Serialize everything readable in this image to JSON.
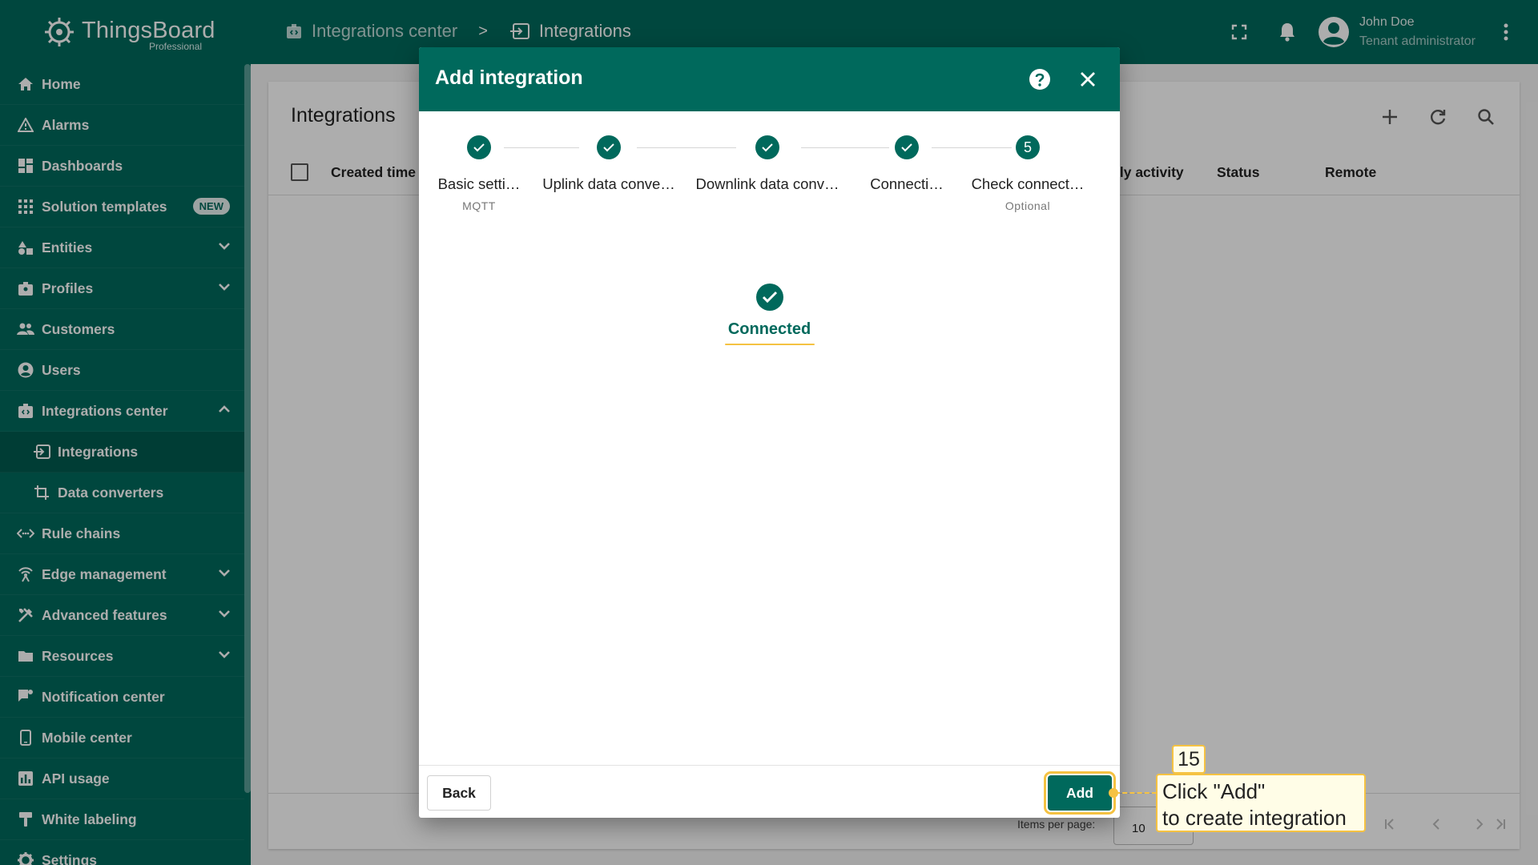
{
  "app": {
    "name": "ThingsBoard",
    "edition": "Professional"
  },
  "breadcrumb": [
    {
      "label": "Integrations center",
      "icon": "integrations-center-icon"
    },
    {
      "label": "Integrations",
      "icon": "integration-icon"
    }
  ],
  "breadcrumb_separator": ">",
  "user": {
    "name": "John Doe",
    "role": "Tenant administrator"
  },
  "sidebar": {
    "items": [
      {
        "label": "Home",
        "icon": "home-icon"
      },
      {
        "label": "Alarms",
        "icon": "alarm-icon"
      },
      {
        "label": "Dashboards",
        "icon": "dashboard-icon"
      },
      {
        "label": "Solution templates",
        "icon": "apps-icon",
        "badge": "NEW"
      },
      {
        "label": "Entities",
        "icon": "entities-icon"
      },
      {
        "label": "Profiles",
        "icon": "profiles-icon"
      },
      {
        "label": "Customers",
        "icon": "customers-icon"
      },
      {
        "label": "Users",
        "icon": "user-icon"
      },
      {
        "label": "Integrations center",
        "icon": "integrations-center-icon"
      },
      {
        "label": "Integrations",
        "icon": "integration-icon"
      },
      {
        "label": "Data converters",
        "icon": "converter-icon"
      },
      {
        "label": "Rule chains",
        "icon": "rule-chain-icon"
      },
      {
        "label": "Edge management",
        "icon": "edge-icon"
      },
      {
        "label": "Advanced features",
        "icon": "tools-icon"
      },
      {
        "label": "Resources",
        "icon": "folder-icon"
      },
      {
        "label": "Notification center",
        "icon": "notification-icon"
      },
      {
        "label": "Mobile center",
        "icon": "mobile-icon"
      },
      {
        "label": "API usage",
        "icon": "chart-icon"
      },
      {
        "label": "White labeling",
        "icon": "brush-icon"
      },
      {
        "label": "Settings",
        "icon": "gear-icon"
      }
    ]
  },
  "page": {
    "title": "Integrations",
    "columns": [
      "Created time",
      "ily activity",
      "Status",
      "Remote"
    ],
    "items_per_page_label": "Items per page:",
    "items_per_page": "10"
  },
  "dialog": {
    "title": "Add integration",
    "steps": [
      {
        "label": "Basic setti…",
        "sub": "MQTT",
        "state": "done"
      },
      {
        "label": "Uplink data conve…",
        "sub": "",
        "state": "done"
      },
      {
        "label": "Downlink data conv…",
        "sub": "",
        "state": "done"
      },
      {
        "label": "Connecti…",
        "sub": "",
        "state": "done"
      },
      {
        "label": "Check connect…",
        "sub": "Optional",
        "state": "current",
        "number": "5"
      }
    ],
    "status": "Connected",
    "back_label": "Back",
    "add_label": "Add"
  },
  "callout": {
    "number": "15",
    "line1": "Click \"Add\"",
    "line2": "to create integration"
  },
  "colors": {
    "primary": "#00695c",
    "highlight": "#f5c242"
  }
}
